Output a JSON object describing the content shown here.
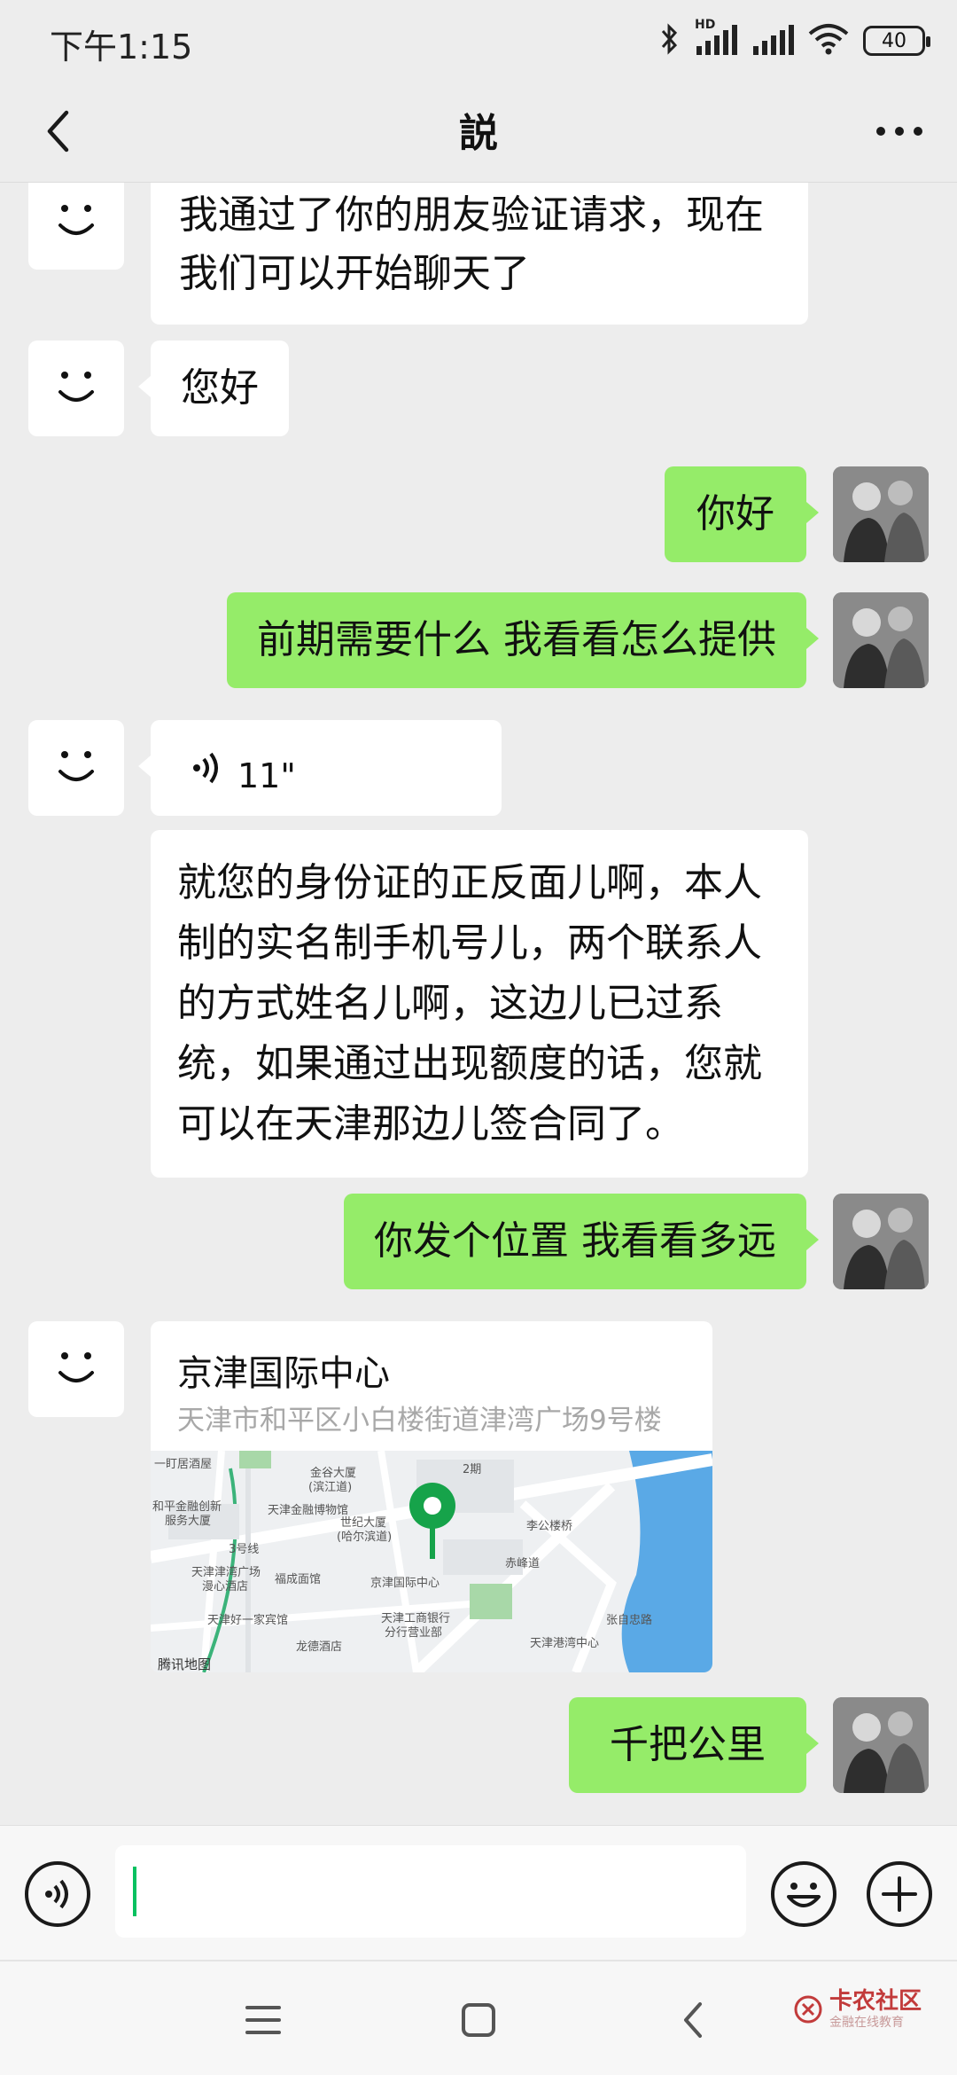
{
  "status_bar": {
    "time": "下午1:15",
    "network_label": "HD",
    "battery": "40"
  },
  "header": {
    "title": "説",
    "back_icon": "chevron-left-icon",
    "more_icon": "more-dots-icon"
  },
  "messages": [
    {
      "side": "in",
      "type": "text",
      "text": "我通过了你的朋友验证请求，现在我们可以开始聊天了"
    },
    {
      "side": "in",
      "type": "text",
      "text": "您好"
    },
    {
      "side": "out",
      "type": "text",
      "text": "你好"
    },
    {
      "side": "out",
      "type": "text",
      "text": "前期需要什么 我看看怎么提供"
    },
    {
      "side": "in",
      "type": "voice",
      "duration": "11\""
    },
    {
      "side": "in",
      "type": "text",
      "text": "就您的身份证的正反面儿啊，本人制的实名制手机号儿，两个联系人的方式姓名儿啊，这边儿已过系统，如果通过出现额度的话，您就可以在天津那边儿签合同了。"
    },
    {
      "side": "out",
      "type": "text",
      "text": "你发个位置 我看看多远"
    },
    {
      "side": "in",
      "type": "location",
      "name": "京津国际中心",
      "address": "天津市和平区小白楼街道津湾广场9号楼"
    },
    {
      "side": "out",
      "type": "text",
      "text": "千把公里"
    }
  ],
  "map": {
    "labels": [
      "一盯居酒屋",
      "金谷大厦",
      "(滨江道)",
      "天津金融博物馆",
      "世纪大厦",
      "(哈尔滨道)",
      "和平金融创新",
      "服务大厦",
      "3号线",
      "天津津湾广场",
      "漫心酒店",
      "福成面馆",
      "京津国际中心",
      "天津好一家宾馆",
      "龙德酒店",
      "天津工商银行",
      "分行营业部",
      "天津港湾中心",
      "赤峰道",
      "李公楼桥",
      "张自忠路",
      "2期",
      "腾讯地图"
    ]
  },
  "input_bar": {
    "voice_icon": "voice-input-icon",
    "emoji_icon": "emoji-icon",
    "plus_icon": "plus-icon"
  },
  "nav_bar": {
    "menu_icon": "menu-icon",
    "home_icon": "home-icon",
    "back_icon": "back-icon"
  },
  "watermark": {
    "title": "卡农社区",
    "subtitle": "金融在线教育"
  },
  "colors": {
    "background": "#ededed",
    "bubble_out": "#95ec69",
    "bubble_in": "#ffffff",
    "accent_green": "#07c160",
    "map_pin": "#16a34a",
    "water": "#5aa9e6"
  }
}
